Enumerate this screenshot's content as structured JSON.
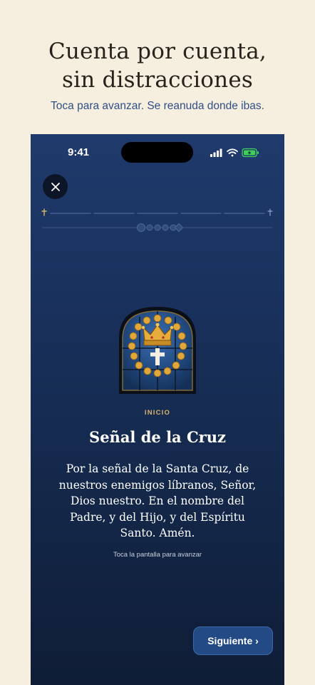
{
  "header": {
    "title_line1": "Cuenta por cuenta,",
    "title_line2": "sin distracciones",
    "subtitle": "Toca para avanzar. Se reanuda donde ibas."
  },
  "status_bar": {
    "time": "9:41"
  },
  "prayer": {
    "section": "INICIO",
    "title": "Señal de la Cruz",
    "text": "Por la señal de la Santa Cruz, de nuestros enemigos líbranos, Señor, Dios nuestro. En el nombre del Padre, y del Hijo, y del Espíritu Santo. Amén.",
    "hint": "Toca la pantalla para avanzar"
  },
  "next_button": {
    "label": "Siguiente ›"
  },
  "colors": {
    "background": "#f6efe0",
    "accent_gold": "#d8b36a",
    "button_blue": "#234a85",
    "screen_top": "#1f3a6c",
    "screen_bottom": "#0f1d36"
  },
  "icons": [
    "close-icon",
    "cross-icon",
    "signal-icon",
    "wifi-icon",
    "battery-icon",
    "crown-icon"
  ]
}
